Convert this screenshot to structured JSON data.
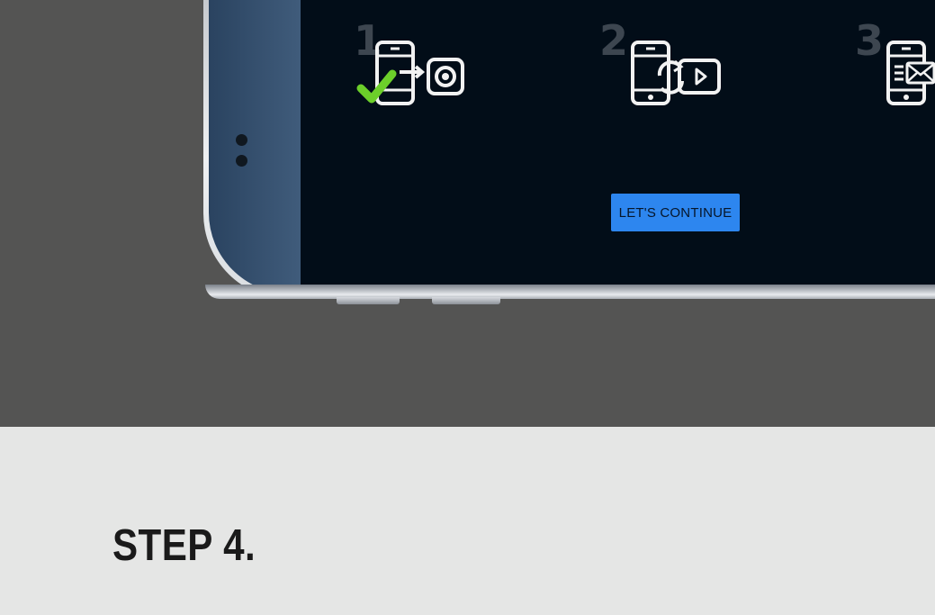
{
  "hero": {
    "steps": [
      {
        "number": "1",
        "icon": "phone-transfer-camera-icon",
        "completed": true
      },
      {
        "number": "2",
        "icon": "phone-sync-video-icon",
        "completed": false
      },
      {
        "number": "3",
        "icon": "phone-mail-icon",
        "completed": false
      }
    ],
    "continue_label": "LET'S CONTINUE",
    "colors": {
      "button": "#2d86ef",
      "check": "#6ccf2a",
      "screen": "#020d18",
      "background": "#545453"
    }
  },
  "content": {
    "title": "STEP 4.",
    "description_partial": ""
  }
}
